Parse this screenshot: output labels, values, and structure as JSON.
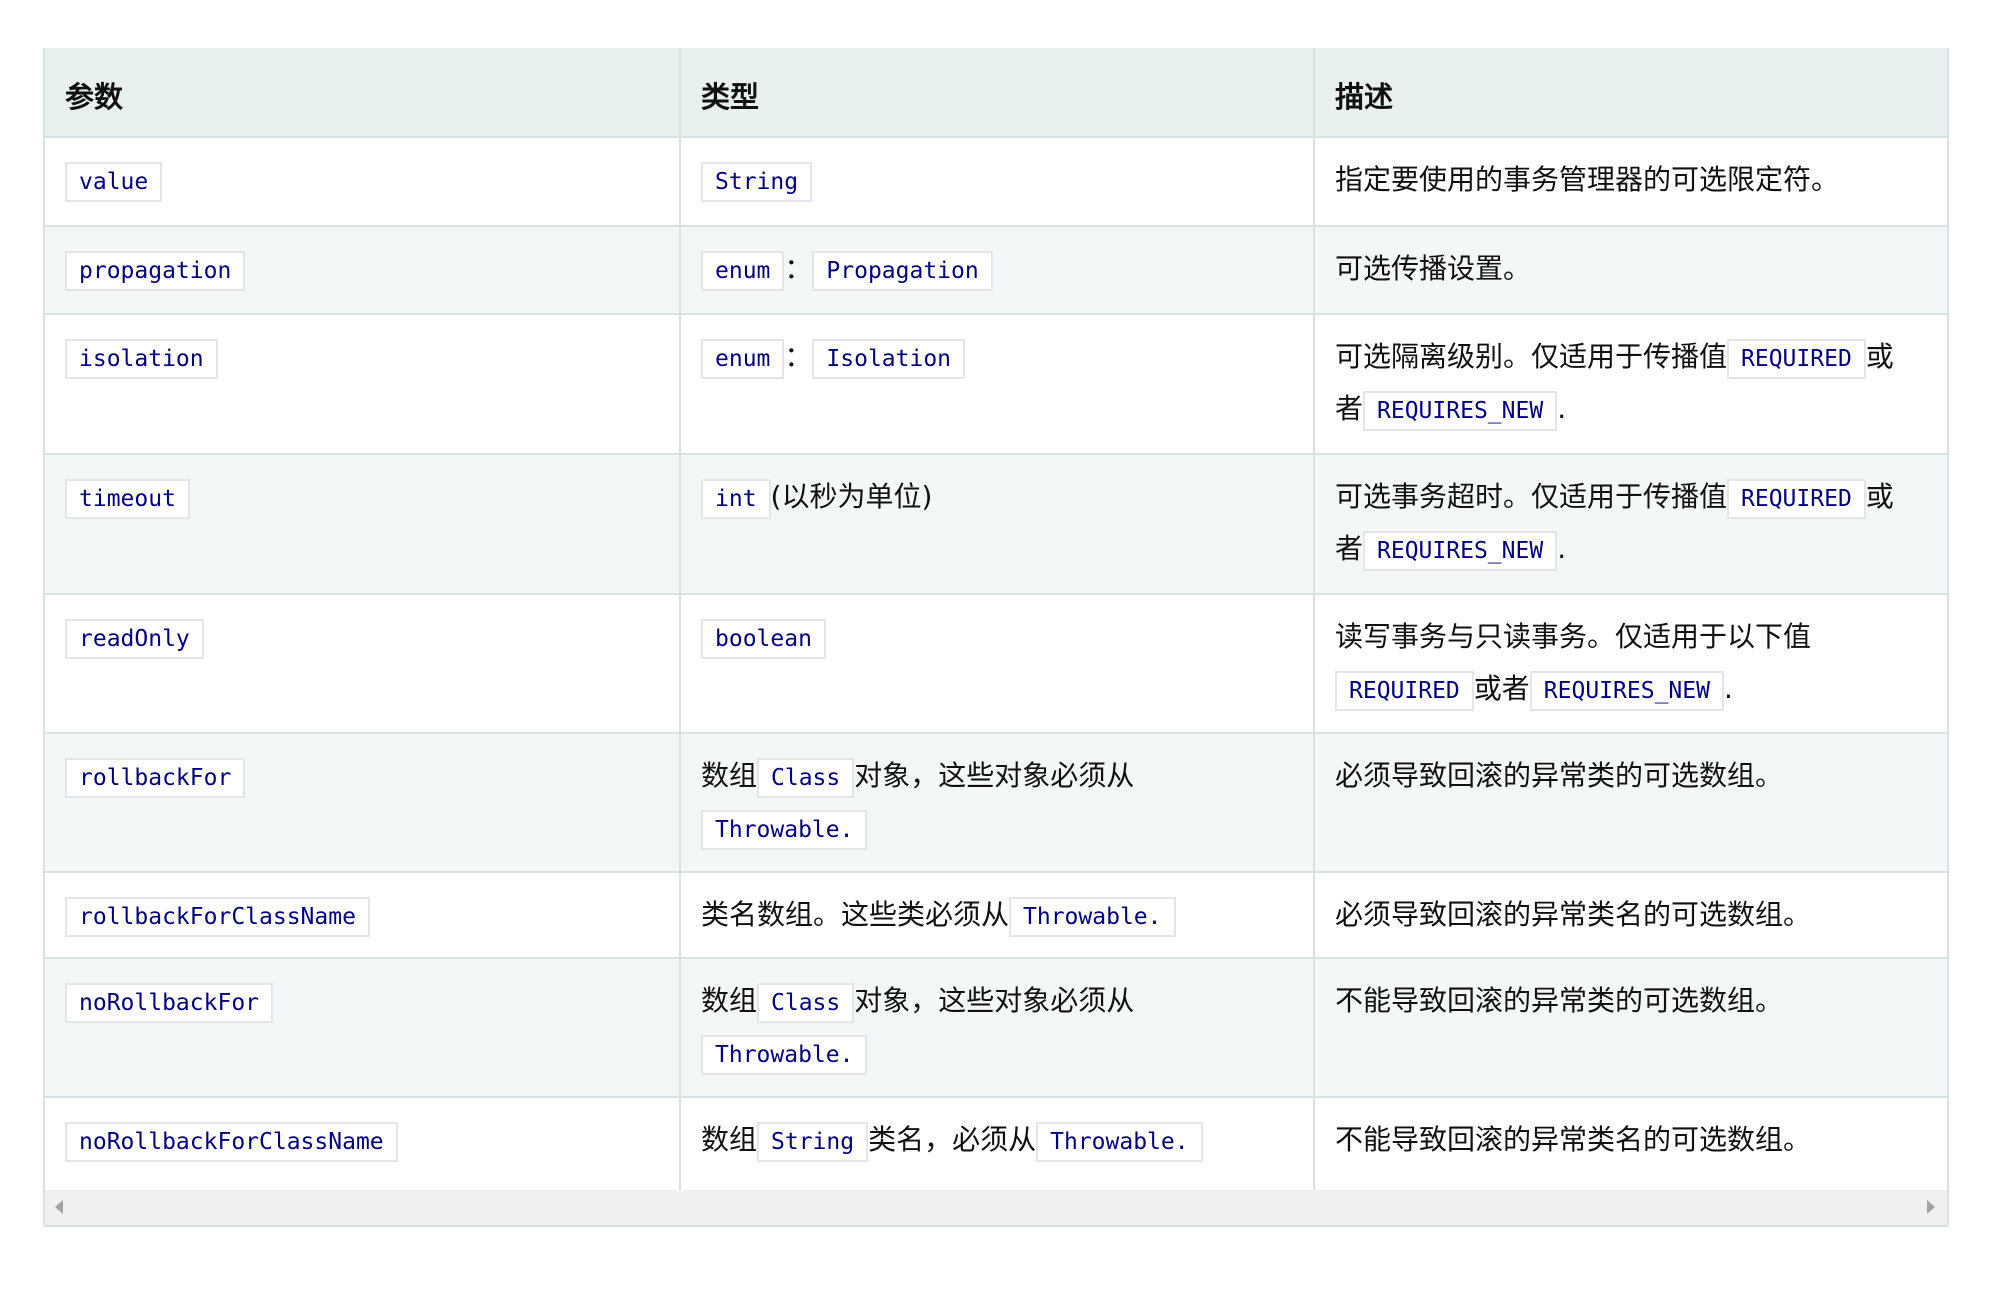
{
  "table": {
    "headers": [
      "参数",
      "类型",
      "描述"
    ],
    "rows": [
      {
        "param": "value",
        "type": [
          {
            "code": "String"
          }
        ],
        "desc": [
          {
            "text": "指定要使用的事务管理器的可选限定符。"
          }
        ]
      },
      {
        "param": "propagation",
        "type": [
          {
            "code": "enum"
          },
          {
            "text": "："
          },
          {
            "code": "Propagation"
          }
        ],
        "desc": [
          {
            "text": "可选传播设置。"
          }
        ]
      },
      {
        "param": "isolation",
        "type": [
          {
            "code": "enum"
          },
          {
            "text": "："
          },
          {
            "code": "Isolation"
          }
        ],
        "desc": [
          {
            "text": "可选隔离级别。仅适用于传播值"
          },
          {
            "code": "REQUIRED"
          },
          {
            "text": "或者"
          },
          {
            "code": "REQUIRES_NEW"
          },
          {
            "text": "."
          }
        ]
      },
      {
        "param": "timeout",
        "type": [
          {
            "code": "int"
          },
          {
            "text": "(以秒为单位)"
          }
        ],
        "desc": [
          {
            "text": "可选事务超时。仅适用于传播值"
          },
          {
            "code": "REQUIRED"
          },
          {
            "text": "或者"
          },
          {
            "code": "REQUIRES_NEW"
          },
          {
            "text": "."
          }
        ]
      },
      {
        "param": "readOnly",
        "type": [
          {
            "code": "boolean"
          }
        ],
        "desc": [
          {
            "text": "读写事务与只读事务。仅适用于以下值"
          },
          {
            "code": "REQUIRED"
          },
          {
            "text": "或者"
          },
          {
            "code": "REQUIRES_NEW"
          },
          {
            "text": "."
          }
        ]
      },
      {
        "param": "rollbackFor",
        "type": [
          {
            "text": "数组"
          },
          {
            "code": "Class"
          },
          {
            "text": "对象，这些对象必须从"
          },
          {
            "code": "Throwable."
          }
        ],
        "desc": [
          {
            "text": "必须导致回滚的异常类的可选数组。"
          }
        ]
      },
      {
        "param": "rollbackForClassName",
        "type": [
          {
            "text": "类名数组。这些类必须从"
          },
          {
            "code": "Throwable."
          }
        ],
        "desc": [
          {
            "text": "必须导致回滚的异常类名的可选数组。"
          }
        ]
      },
      {
        "param": "noRollbackFor",
        "type": [
          {
            "text": "数组"
          },
          {
            "code": "Class"
          },
          {
            "text": "对象，这些对象必须从"
          },
          {
            "code": "Throwable."
          }
        ],
        "desc": [
          {
            "text": "不能导致回滚的异常类的可选数组。"
          }
        ]
      },
      {
        "param": "noRollbackForClassName",
        "type": [
          {
            "text": "数组"
          },
          {
            "code": "String"
          },
          {
            "text": "类名，必须从"
          },
          {
            "code": "Throwable."
          }
        ],
        "desc": [
          {
            "text": "不能导致回滚的异常类名的可选数组。"
          }
        ]
      }
    ]
  },
  "scrollbar": {
    "left_icon": "arrow-left-icon",
    "right_icon": "arrow-right-icon"
  },
  "colors": {
    "code_text": "#000080",
    "header_bg": "#e8f0f0",
    "stripe_bg": "#f4f7f8",
    "border": "#d9e2e2"
  }
}
